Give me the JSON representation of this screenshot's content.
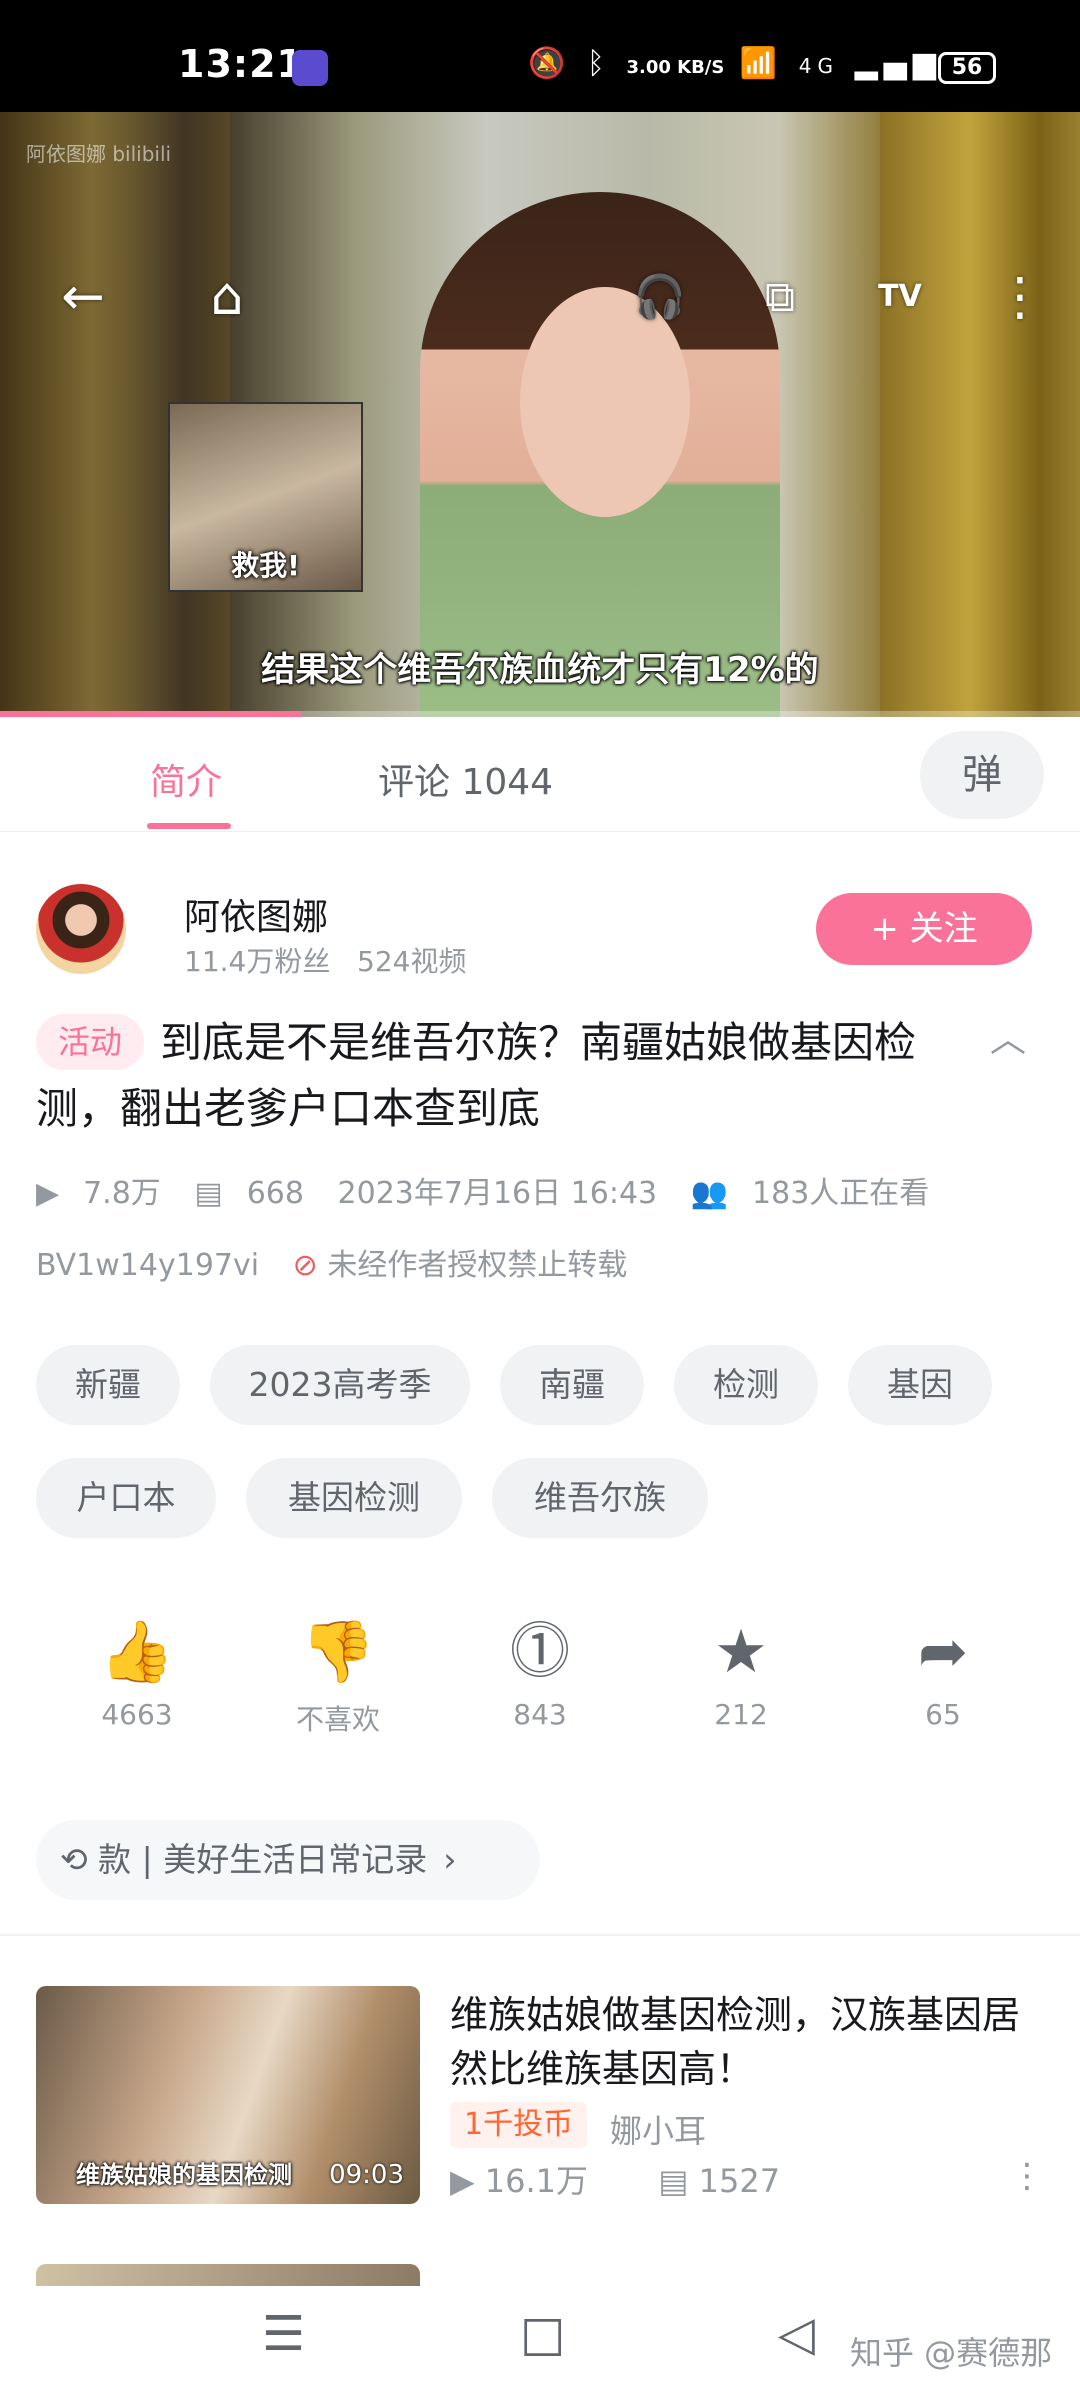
{
  "status_bar": {
    "time": "13:21",
    "network_speed": "3.00 KB/S",
    "signal": "4G",
    "battery": "56"
  },
  "video": {
    "watermark": "阿依图娜 bilibili",
    "sticker_text": "救我!",
    "subtitle": "结果这个维吾尔族血统才只有12%的",
    "progress": 0.28
  },
  "tabs": {
    "intro": "简介",
    "comments": "评论 1044",
    "danmaku_icon": "弹"
  },
  "uploader": {
    "name": "阿依图娜",
    "stats": "11.4万粉丝   524视频",
    "follow_label": "+ 关注"
  },
  "video_info": {
    "badge": "活动",
    "title": "到底是不是维吾尔族？南疆姑娘做基因检测，翻出老爹户口本查到底",
    "views": "7.8万",
    "danmaku": "668",
    "date": "2023年7月16日 16:43",
    "watching": "183人正在看",
    "bvid": "BV1w14y197vi",
    "copyright": "未经作者授权禁止转载"
  },
  "tags": [
    "新疆",
    "2023高考季",
    "南疆",
    "检测",
    "基因",
    "户口本",
    "基因检测",
    "维吾尔族"
  ],
  "actions": [
    {
      "icon": "thumbs-up-icon",
      "label": "4663"
    },
    {
      "icon": "thumbs-down-icon",
      "label": "不喜欢"
    },
    {
      "icon": "coin-icon",
      "label": "843"
    },
    {
      "icon": "star-icon",
      "label": "212"
    },
    {
      "icon": "share-icon",
      "label": "65"
    }
  ],
  "collection": "款 | 美好生活日常记录",
  "recommend": {
    "thumb_caption": "维族姑娘的基因检测",
    "duration": "09:03",
    "title": "维族姑娘做基因检测，汉族基因居然比维族基因高！",
    "badge": "1千投币",
    "up": "娜小耳",
    "views": "16.1万",
    "danmaku": "1527"
  },
  "watermark_bottom": "知乎 @赛德那"
}
